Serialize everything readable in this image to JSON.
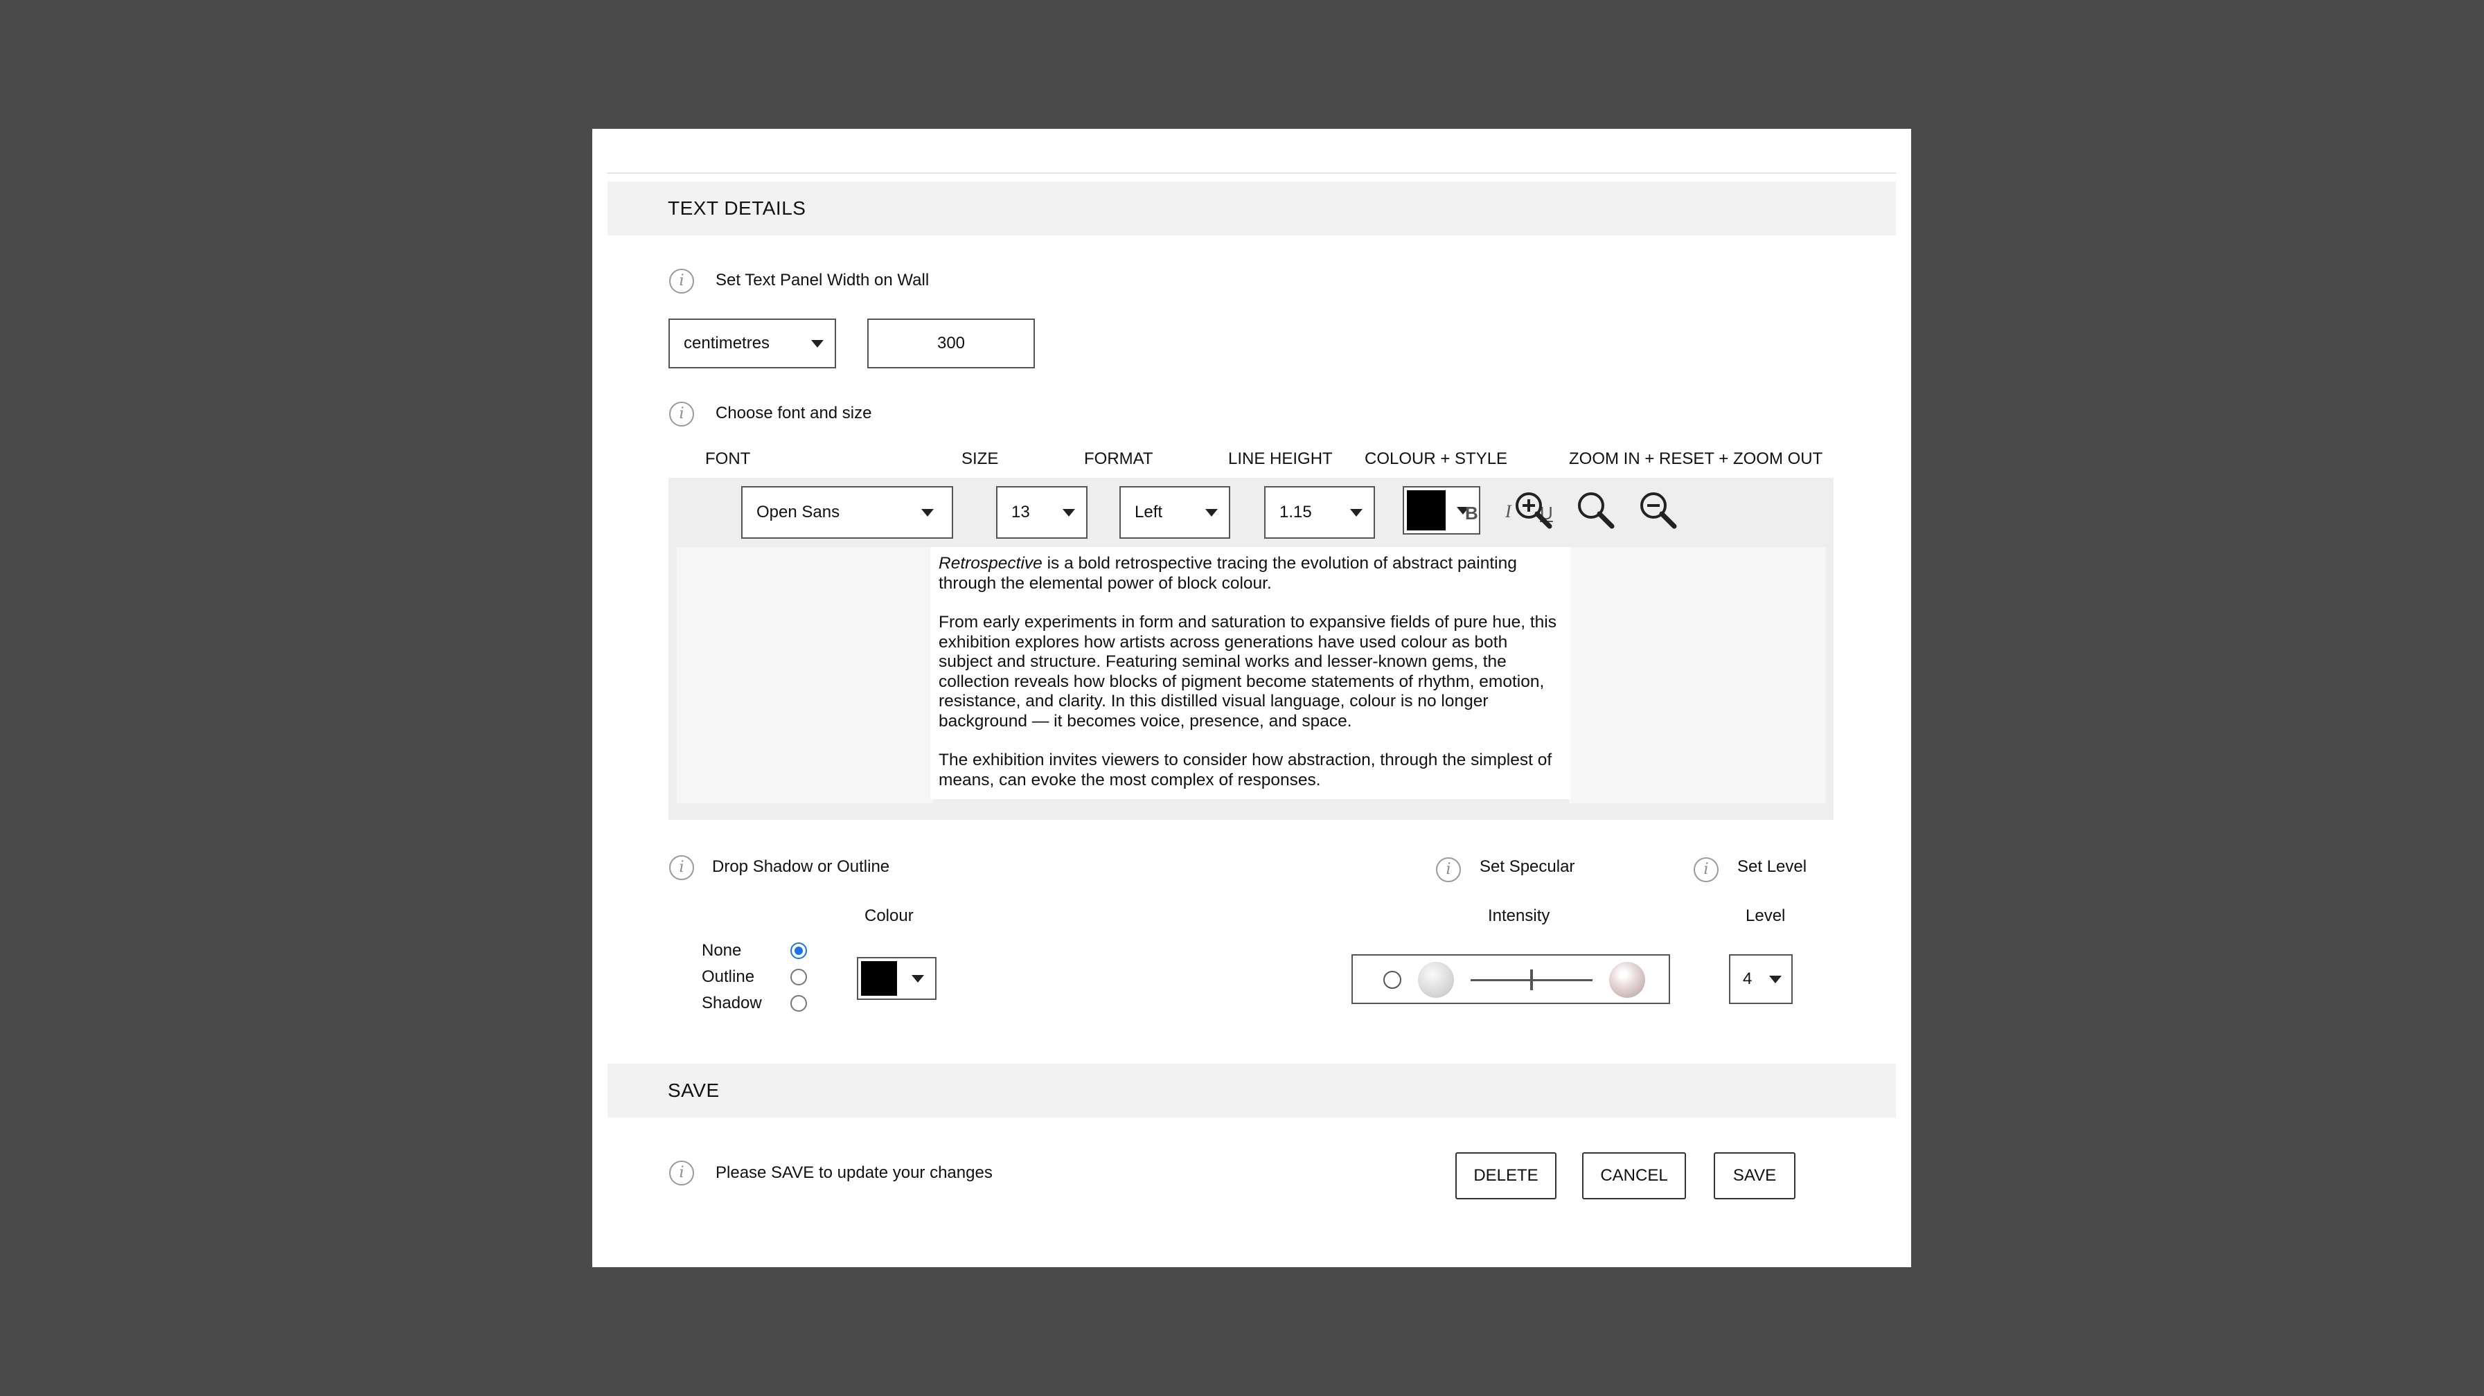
{
  "text_details": {
    "header": "TEXT DETAILS",
    "panel_width": {
      "label": "Set Text Panel Width on Wall",
      "unit": "centimetres",
      "value": "300"
    },
    "font_section": {
      "label": "Choose font and size",
      "columns": {
        "font": "FONT",
        "size": "SIZE",
        "format": "FORMAT",
        "line_height": "LINE HEIGHT",
        "colour_style": "COLOUR + STYLE",
        "zoom": "ZOOM IN + RESET + ZOOM OUT"
      },
      "font_value": "Open Sans",
      "size_value": "13",
      "format_value": "Left",
      "line_height_value": "1.15",
      "colour_value": "#000000",
      "bold": "B",
      "italic": "I",
      "underline": "U"
    },
    "editor": {
      "title_italic": "Retrospective",
      "para1_rest": " is a bold retrospective tracing the evolution of abstract painting through the elemental power of block colour.",
      "para2": "From early experiments in form and saturation to expansive fields of pure hue, this exhibition explores how artists across generations have used colour as both subject and structure. Featuring seminal works and lesser-known gems, the collection reveals how blocks of pigment become statements of rhythm, emotion, resistance, and clarity. In this distilled visual language, colour is no longer background — it becomes voice, presence, and space.",
      "para3": "The exhibition invites viewers to consider how abstraction, through the simplest of means, can evoke the most complex of responses."
    },
    "shadow": {
      "label": "Drop Shadow or Outline",
      "colour_label": "Colour",
      "options": [
        "None",
        "Outline",
        "Shadow"
      ],
      "selected": "None",
      "colour_value": "#000000"
    },
    "specular": {
      "label": "Set Specular",
      "intensity_label": "Intensity",
      "intensity": 0.5
    },
    "level": {
      "label": "Set Level",
      "level_label": "Level",
      "value": "4"
    }
  },
  "save_section": {
    "header": "SAVE",
    "message": "Please SAVE to update your changes",
    "delete_label": "DELETE",
    "cancel_label": "CANCEL",
    "save_label": "SAVE"
  }
}
